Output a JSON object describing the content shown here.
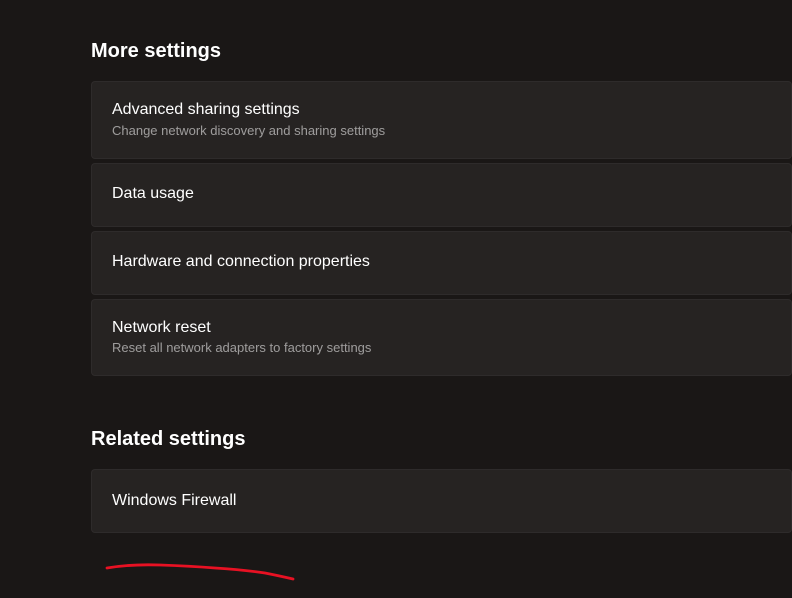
{
  "sections": {
    "more_settings": {
      "heading": "More settings",
      "items": [
        {
          "title": "Advanced sharing settings",
          "subtitle": "Change network discovery and sharing settings"
        },
        {
          "title": "Data usage",
          "subtitle": null
        },
        {
          "title": "Hardware and connection properties",
          "subtitle": null
        },
        {
          "title": "Network reset",
          "subtitle": "Reset all network adapters to factory settings"
        }
      ]
    },
    "related_settings": {
      "heading": "Related settings",
      "items": [
        {
          "title": "Windows Firewall",
          "subtitle": null
        }
      ]
    }
  },
  "annotation": {
    "color": "#e81123",
    "type": "hand-underline"
  }
}
